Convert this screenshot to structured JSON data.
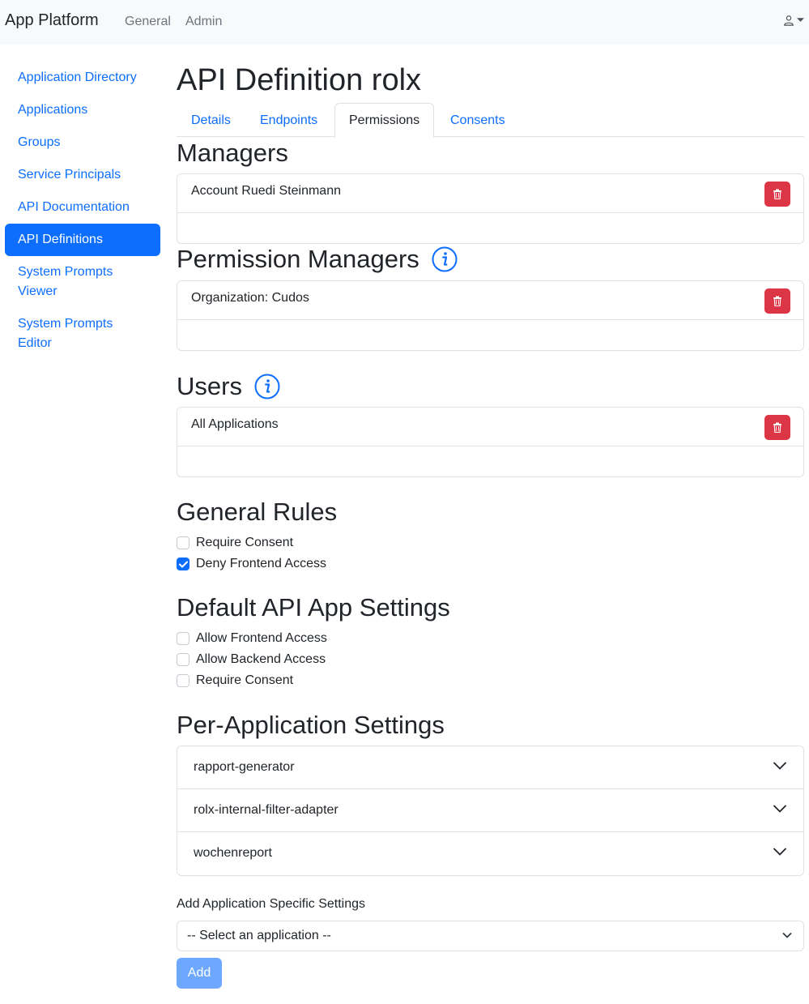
{
  "navbar": {
    "brand": "App Platform",
    "links": [
      "General",
      "Admin"
    ]
  },
  "sidebar": {
    "items": [
      {
        "label": "Application Directory"
      },
      {
        "label": "Applications"
      },
      {
        "label": "Groups"
      },
      {
        "label": "Service Principals"
      },
      {
        "label": "API Documentation"
      },
      {
        "label": "API Definitions",
        "active": true
      },
      {
        "label": "System Prompts Viewer"
      },
      {
        "label": "System Prompts Editor"
      }
    ]
  },
  "page": {
    "title": "API Definition rolx",
    "tabs": [
      "Details",
      "Endpoints",
      "Permissions",
      "Consents"
    ],
    "active_tab": "Permissions"
  },
  "managers": {
    "title": "Managers",
    "entries": [
      "Account Ruedi Steinmann"
    ]
  },
  "permission_managers": {
    "title": "Permission Managers",
    "entries": [
      "Organization: Cudos"
    ]
  },
  "users": {
    "title": "Users",
    "entries": [
      "All Applications"
    ]
  },
  "general_rules": {
    "title": "General Rules",
    "options": [
      {
        "label": "Require Consent",
        "checked": false
      },
      {
        "label": "Deny Frontend Access",
        "checked": true
      }
    ]
  },
  "default_settings": {
    "title": "Default API App Settings",
    "options": [
      {
        "label": "Allow Frontend Access",
        "checked": false
      },
      {
        "label": "Allow Backend Access",
        "checked": false
      },
      {
        "label": "Require Consent",
        "checked": false
      }
    ]
  },
  "per_app": {
    "title": "Per-Application Settings",
    "apps": [
      "rapport-generator",
      "rolx-internal-filter-adapter",
      "wochenreport"
    ]
  },
  "add_settings": {
    "label": "Add Application Specific Settings",
    "select_value": "-- Select an application --",
    "button": "Add"
  },
  "colors": {
    "primary": "#0d6efd",
    "danger": "#dc3545",
    "disabled_primary": "#6ea8fe"
  }
}
